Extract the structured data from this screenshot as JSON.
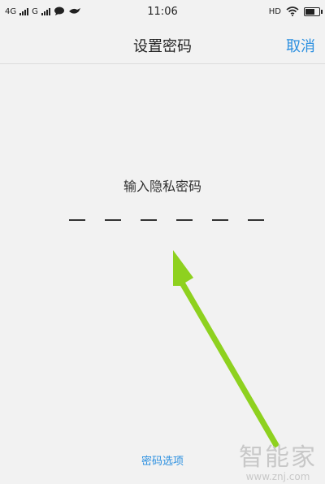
{
  "status_bar": {
    "network_1": "4G",
    "network_2": "G",
    "time": "11:06",
    "hd_label": "HD",
    "icons": [
      "signal-bars-icon",
      "message-bubble-icon",
      "bird-icon",
      "wifi-icon",
      "battery-icon"
    ],
    "battery_level": 0.75
  },
  "nav": {
    "title": "设置密码",
    "cancel_label": "取消"
  },
  "main": {
    "prompt": "输入隐私密码",
    "pin_length": 6
  },
  "footer": {
    "options_label": "密码选项"
  },
  "watermark": {
    "logo_text": "智能家",
    "url": "www.znj.com"
  },
  "colors": {
    "accent": "#2a8fe0",
    "background": "#f2f2f2",
    "arrow": "#8ed11f"
  }
}
